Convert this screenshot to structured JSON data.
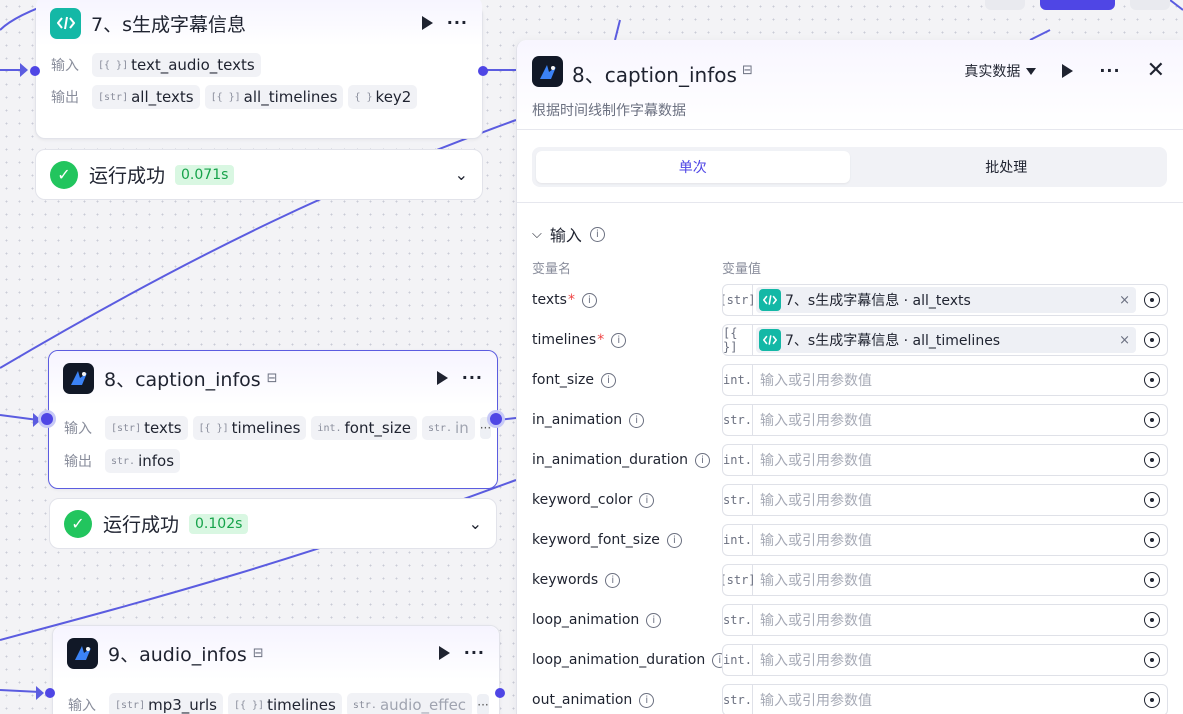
{
  "nodes": {
    "node7": {
      "title": "7、s生成字幕信息",
      "input_label": "输入",
      "output_label": "输出",
      "inputs": [
        {
          "type": "[{ }]",
          "name": "text_audio_texts"
        }
      ],
      "outputs": [
        {
          "type": "[str]",
          "name": "all_texts"
        },
        {
          "type": "[{ }]",
          "name": "all_timelines"
        },
        {
          "type": "{ }",
          "name": "key2"
        }
      ],
      "status": {
        "text": "运行成功",
        "time": "0.071s"
      }
    },
    "node8": {
      "title": "8、caption_infos",
      "input_label": "输入",
      "output_label": "输出",
      "inputs": [
        {
          "type": "[str]",
          "name": "texts"
        },
        {
          "type": "[{ }]",
          "name": "timelines"
        },
        {
          "type": "int.",
          "name": "font_size"
        },
        {
          "type": "str.",
          "name": "in"
        }
      ],
      "more": "···",
      "outputs": [
        {
          "type": "str.",
          "name": "infos"
        }
      ],
      "status": {
        "text": "运行成功",
        "time": "0.102s"
      }
    },
    "node9": {
      "title": "9、audio_infos",
      "input_label": "输入",
      "inputs": [
        {
          "type": "[str]",
          "name": "mp3_urls"
        },
        {
          "type": "[{ }]",
          "name": "timelines"
        },
        {
          "type": "str.",
          "name": "audio_effec"
        }
      ],
      "more": "···"
    }
  },
  "panel": {
    "title": "8、caption_infos",
    "description": "根据时间线制作字幕数据",
    "data_mode": "真实数据",
    "tabs": [
      {
        "label": "单次",
        "active": true
      },
      {
        "label": "批处理",
        "active": false
      }
    ],
    "section_title": "输入",
    "col_name": "变量名",
    "col_value": "变量值",
    "params": [
      {
        "name": "texts",
        "required": true,
        "type": "[str]",
        "ref_text": "7、s生成字幕信息 · all_texts"
      },
      {
        "name": "timelines",
        "required": true,
        "type": "[{ }]",
        "ref_text": "7、s生成字幕信息 · all_timelines"
      },
      {
        "name": "font_size",
        "required": false,
        "type": "int.",
        "placeholder": "输入或引用参数值"
      },
      {
        "name": "in_animation",
        "required": false,
        "type": "str.",
        "placeholder": "输入或引用参数值"
      },
      {
        "name": "in_animation_duration",
        "required": false,
        "type": "int.",
        "placeholder": "输入或引用参数值"
      },
      {
        "name": "keyword_color",
        "required": false,
        "type": "str.",
        "placeholder": "输入或引用参数值"
      },
      {
        "name": "keyword_font_size",
        "required": false,
        "type": "int.",
        "placeholder": "输入或引用参数值"
      },
      {
        "name": "keywords",
        "required": false,
        "type": "[str]",
        "placeholder": "输入或引用参数值"
      },
      {
        "name": "loop_animation",
        "required": false,
        "type": "str.",
        "placeholder": "输入或引用参数值"
      },
      {
        "name": "loop_animation_duration",
        "required": false,
        "type": "int.",
        "placeholder": "输入或引用参数值"
      },
      {
        "name": "out_animation",
        "required": false,
        "type": "str.",
        "placeholder": "输入或引用参数值"
      }
    ]
  },
  "colors": {
    "accent": "#4f46e5",
    "success": "#22c55e",
    "code_node": "#14b8a6"
  }
}
